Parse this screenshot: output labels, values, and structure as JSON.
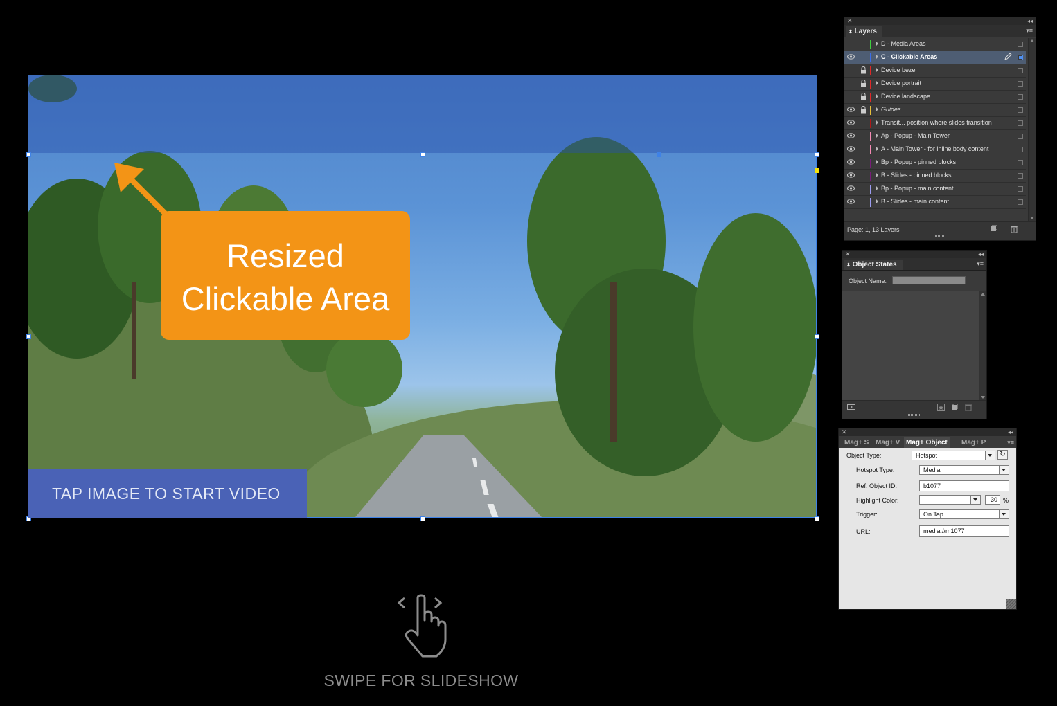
{
  "canvas": {
    "callout_line1": "Resized",
    "callout_line2": "Clickable Area",
    "tap_banner": "TAP IMAGE TO START VIDEO",
    "swipe_label": "SWIPE FOR SLIDESHOW"
  },
  "layers_panel": {
    "title": "Layers",
    "footer": "Page: 1, 13 Layers",
    "layers": [
      {
        "name": "D - Media Areas",
        "color": "#3ecf3e",
        "visible": false,
        "locked": false
      },
      {
        "name": "C - Clickable Areas",
        "color": "#3c6ee8",
        "visible": true,
        "locked": false,
        "selected": true
      },
      {
        "name": "Device bezel",
        "color": "#e02828",
        "visible": false,
        "locked": true
      },
      {
        "name": "Device portrait",
        "color": "#e02828",
        "visible": false,
        "locked": true
      },
      {
        "name": "Device landscape",
        "color": "#e02828",
        "visible": false,
        "locked": true
      },
      {
        "name": "Guides",
        "color": "#e8c03a",
        "visible": true,
        "locked": true
      },
      {
        "name": "Transit... position where slides transition",
        "color": "#b01818",
        "visible": true,
        "locked": false
      },
      {
        "name": "Ap - Popup - Main Tower",
        "color": "#f58ab4",
        "visible": true,
        "locked": false
      },
      {
        "name": "A - Main Tower - for inline body content",
        "color": "#f58ab4",
        "visible": true,
        "locked": false
      },
      {
        "name": "Bp - Popup - pinned blocks",
        "color": "#7a1c7a",
        "visible": true,
        "locked": false
      },
      {
        "name": "B - Slides - pinned blocks",
        "color": "#7a1c7a",
        "visible": true,
        "locked": false
      },
      {
        "name": "Bp - Popup - main content",
        "color": "#9c9cf0",
        "visible": true,
        "locked": false
      },
      {
        "name": "B - Slides - main content",
        "color": "#9c9cf0",
        "visible": true,
        "locked": false
      }
    ]
  },
  "object_states_panel": {
    "title": "Object States",
    "object_name_label": "Object Name:",
    "object_name_value": ""
  },
  "mag_panel": {
    "tabs": [
      "Mag+ S",
      "Mag+ V",
      "Mag+ Object",
      "Mag+ P"
    ],
    "active_tab": "Mag+ Object",
    "fields": {
      "object_type_label": "Object Type:",
      "object_type_value": "Hotspot",
      "hotspot_type_label": "Hotspot Type:",
      "hotspot_type_value": "Media",
      "ref_object_id_label": "Ref. Object ID:",
      "ref_object_id_value": "b1077",
      "highlight_color_label": "Highlight Color:",
      "highlight_color_value": "",
      "highlight_percent_value": "30",
      "percent_sign": "%",
      "trigger_label": "Trigger:",
      "trigger_value": "On Tap",
      "url_label": "URL:",
      "url_value": "media://m1077"
    }
  }
}
